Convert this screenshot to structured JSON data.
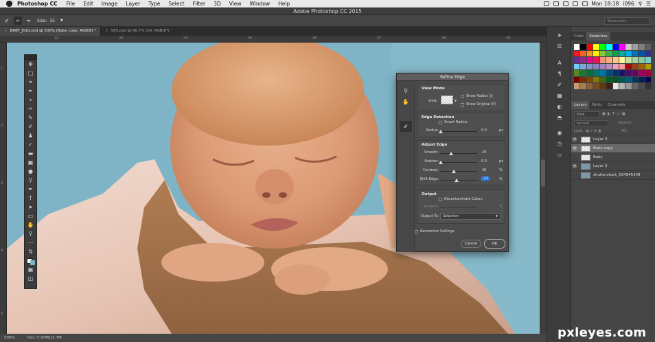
{
  "menubar": {
    "app": "Photoshop CC",
    "items": [
      "File",
      "Edit",
      "Image",
      "Layer",
      "Type",
      "Select",
      "Filter",
      "3D",
      "View",
      "Window",
      "Help"
    ],
    "clock": "Mon 18:18",
    "user": "i096"
  },
  "window_title": "Adobe Photoshop CC 2015",
  "options": {
    "size_label": "Size:",
    "size_value": "35",
    "workspace": "Essentials"
  },
  "tabs": [
    {
      "label": "BABY_EGG.psd @ 500% (Baby copy, RGB/8) *",
      "active": true
    },
    {
      "label": "585.psd @ 66.7% (14, RGB/8*)",
      "active": false
    }
  ],
  "ruler": {
    "h": [
      "22",
      "23",
      "24",
      "25",
      "26",
      "27",
      "28",
      "29"
    ],
    "v": [
      "1",
      "2",
      "3",
      "4",
      "5"
    ]
  },
  "status": {
    "zoom": "500%",
    "doc": "Doc: 5.93M/12.7M"
  },
  "dialog": {
    "title": "Refine Edge",
    "view_mode": {
      "heading": "View Mode",
      "view_label": "View:",
      "show_radius": "Show Radius (J)",
      "show_original": "Show Original (P)"
    },
    "edge_detection": {
      "heading": "Edge Detection",
      "smart_radius": "Smart Radius",
      "radius_label": "Radius:",
      "radius_value": "0.0",
      "radius_unit": "px"
    },
    "adjust_edge": {
      "heading": "Adjust Edge",
      "smooth_label": "Smooth:",
      "smooth_value": "29",
      "feather_label": "Feather:",
      "feather_value": "0.0",
      "feather_unit": "px",
      "contrast_label": "Contrast:",
      "contrast_value": "36",
      "contrast_unit": "%",
      "shift_label": "Shift Edge:",
      "shift_value": "-11",
      "shift_unit": "%"
    },
    "output": {
      "heading": "Output",
      "decontaminate": "Decontaminate Colors",
      "amount_label": "Amount:",
      "amount_unit": "%",
      "output_to_label": "Output To:",
      "output_to_value": "Selection"
    },
    "remember": "Remember Settings",
    "cancel": "Cancel",
    "ok": "OK"
  },
  "panels": {
    "top_tabs": [
      "Color",
      "Swatches"
    ],
    "layer_tabs": [
      "Layers",
      "Paths",
      "Channels"
    ],
    "filter_label": "Kind",
    "blend_mode": "Normal",
    "opacity_label": "Opacity:",
    "lock_label": "Lock:",
    "fill_label": "Fill:",
    "layers": [
      {
        "name": "Layer 3",
        "visible": true,
        "selected": false,
        "thumb": "transparent"
      },
      {
        "name": "Baby copy",
        "visible": true,
        "selected": true,
        "thumb": "transparent"
      },
      {
        "name": "Baby",
        "visible": false,
        "selected": false,
        "thumb": "transparent"
      },
      {
        "name": "Layer 2",
        "visible": true,
        "selected": false,
        "thumb": "image"
      },
      {
        "name": "shutterstock_594945248",
        "visible": false,
        "selected": false,
        "thumb": "image"
      }
    ]
  },
  "swatch_colors": [
    "#ffffff",
    "#000000",
    "#ff0000",
    "#ffff00",
    "#00ff00",
    "#00ffff",
    "#0000ff",
    "#ff00ff",
    "#c8c8c8",
    "#a0a0a0",
    "#808080",
    "#606060",
    "#ed1c24",
    "#f26522",
    "#f7941d",
    "#fff200",
    "#8dc63f",
    "#39b54a",
    "#00a651",
    "#00a99d",
    "#00aeef",
    "#0072bc",
    "#0054a6",
    "#2e3192",
    "#662d91",
    "#92278f",
    "#ec008c",
    "#ed145b",
    "#f69679",
    "#f9ad81",
    "#fdc68a",
    "#fff799",
    "#c4df9b",
    "#a3d39c",
    "#82ca9c",
    "#7accc8",
    "#6dcff6",
    "#7da7d8",
    "#8393ca",
    "#8781bd",
    "#a186be",
    "#bd8cbf",
    "#f49ac2",
    "#f5989d",
    "#9e0b0f",
    "#a0410d",
    "#a36209",
    "#aba000",
    "#598527",
    "#197b30",
    "#007236",
    "#00746b",
    "#0076a3",
    "#004b80",
    "#003471",
    "#1b1464",
    "#440e62",
    "#630460",
    "#9e005d",
    "#9e0039",
    "#790000",
    "#7b2e00",
    "#7d4900",
    "#827b00",
    "#406618",
    "#005e20",
    "#005826",
    "#005952",
    "#005b7f",
    "#003663",
    "#002157",
    "#0d004c",
    "#c69c6d",
    "#a67c52",
    "#8c6239",
    "#754c24",
    "#603913",
    "#3c2415",
    "#e6e6e6",
    "#b3b3b3",
    "#999999",
    "#666666",
    "#4d4d4d",
    "#333333"
  ],
  "watermark": "pxleyes.com"
}
